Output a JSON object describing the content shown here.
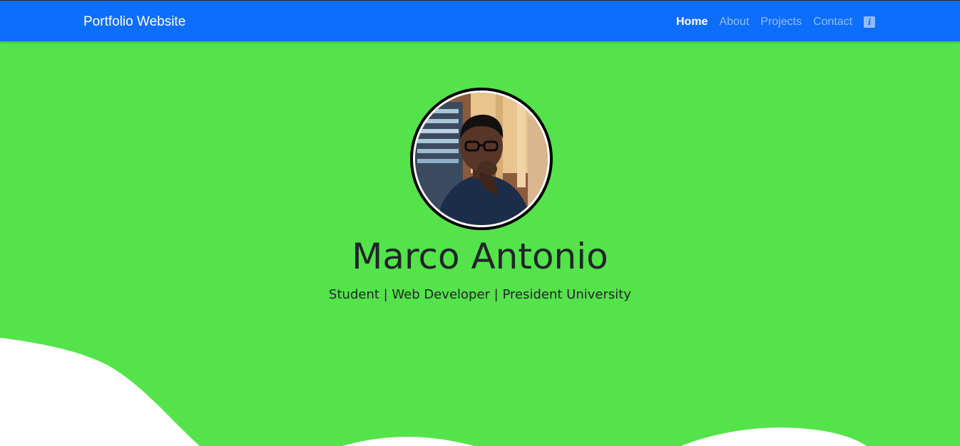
{
  "navbar": {
    "brand": "Portfolio Website",
    "links": [
      {
        "label": "Home",
        "active": true
      },
      {
        "label": "About",
        "active": false
      },
      {
        "label": "Projects",
        "active": false
      },
      {
        "label": "Contact",
        "active": false
      }
    ],
    "extra_icon": "info-icon"
  },
  "hero": {
    "name": "Marco Antonio",
    "subtitle": "Student | Web Developer | President University",
    "avatar_icon": "profile-photo"
  },
  "colors": {
    "navbar_bg": "#0d6efd",
    "hero_bg": "#54e34b",
    "wave_fill": "#ffffff",
    "text": "#212529"
  }
}
